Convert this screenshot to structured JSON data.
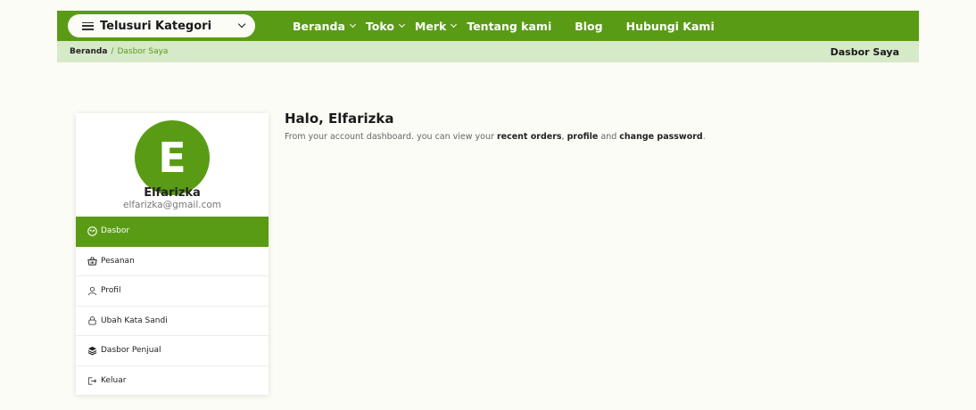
{
  "topbar": {
    "category_button": "Telusuri Kategori",
    "nav": [
      {
        "label": "Beranda",
        "dropdown": true
      },
      {
        "label": "Toko",
        "dropdown": true
      },
      {
        "label": "Merk",
        "dropdown": true
      },
      {
        "label": "Tentang kami",
        "dropdown": false
      },
      {
        "label": "Blog",
        "dropdown": false
      },
      {
        "label": "Hubungi Kami",
        "dropdown": false
      }
    ]
  },
  "breadcrumb": {
    "home": "Beranda",
    "separator": "/",
    "current": "Dasbor Saya",
    "page_title": "Dasbor Saya"
  },
  "profile": {
    "initial": "E",
    "name": "Elfarizka",
    "email": "elfarizka@gmail.com"
  },
  "menu": [
    {
      "label": "Dasbor",
      "icon": "dashboard-icon",
      "active": true
    },
    {
      "label": "Pesanan",
      "icon": "basket-icon",
      "active": false
    },
    {
      "label": "Profil",
      "icon": "user-icon",
      "active": false
    },
    {
      "label": "Ubah Kata Sandi",
      "icon": "lock-icon",
      "active": false
    },
    {
      "label": "Dasbor Penjual",
      "icon": "layers-icon",
      "active": false
    },
    {
      "label": "Keluar",
      "icon": "logout-icon",
      "active": false
    }
  ],
  "main": {
    "greeting": "Halo, Elfarizka",
    "intro_prefix": "From your account dashboard. you can view your ",
    "link_orders": "recent orders",
    "intro_comma": ", ",
    "link_profile": "profile",
    "intro_and": " and ",
    "link_password": "change password",
    "intro_end": "."
  },
  "colors": {
    "brand_green": "#5a9b16",
    "breadcrumb_bg": "#d6e9c8",
    "page_bg": "#fbfcf6"
  }
}
